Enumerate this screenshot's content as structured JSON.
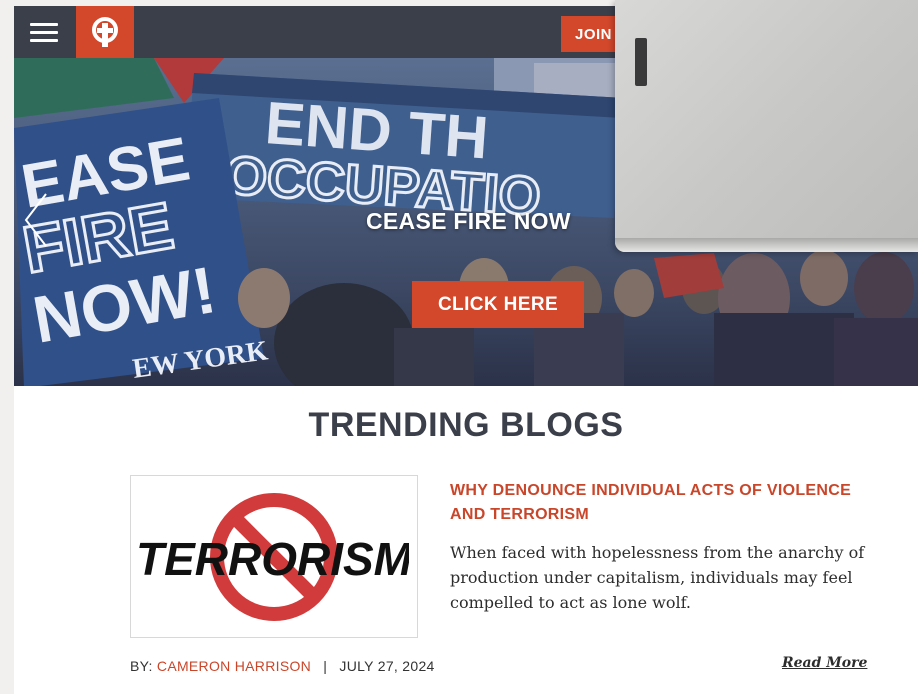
{
  "header": {
    "menu_icon": "hamburger-icon",
    "logo_icon": "party-logo-icon",
    "join_label": "JOIN"
  },
  "hero": {
    "banner_text_1": "END TH",
    "banner_text_2": "OCCUPATIO",
    "sign_text_1": "EASE",
    "sign_text_2": "FIRE",
    "sign_text_3": "NOW!",
    "sign_footer": "EW YORK",
    "title": "CEASE FIRE NOW",
    "cta_label": "CLICK HERE",
    "prev_icon": "chevron-left-icon"
  },
  "trending": {
    "heading": "TRENDING BLOGS",
    "post": {
      "thumb_text": "TERRORISM",
      "title": "WHY DENOUNCE INDIVIDUAL ACTS OF VIOLENCE AND TERRORISM",
      "excerpt": "When faced with hopelessness from the anarchy of production under capitalism, individuals may feel compelled to act as lone wolf.",
      "by_label": "BY:",
      "author": "CAMERON HARRISON",
      "separator": "|",
      "date": "JULY 27, 2024",
      "read_more": "Read More"
    }
  },
  "colors": {
    "accent": "#d3472b",
    "header_bg": "#3b3f4a",
    "heading": "#3b3f4a"
  }
}
